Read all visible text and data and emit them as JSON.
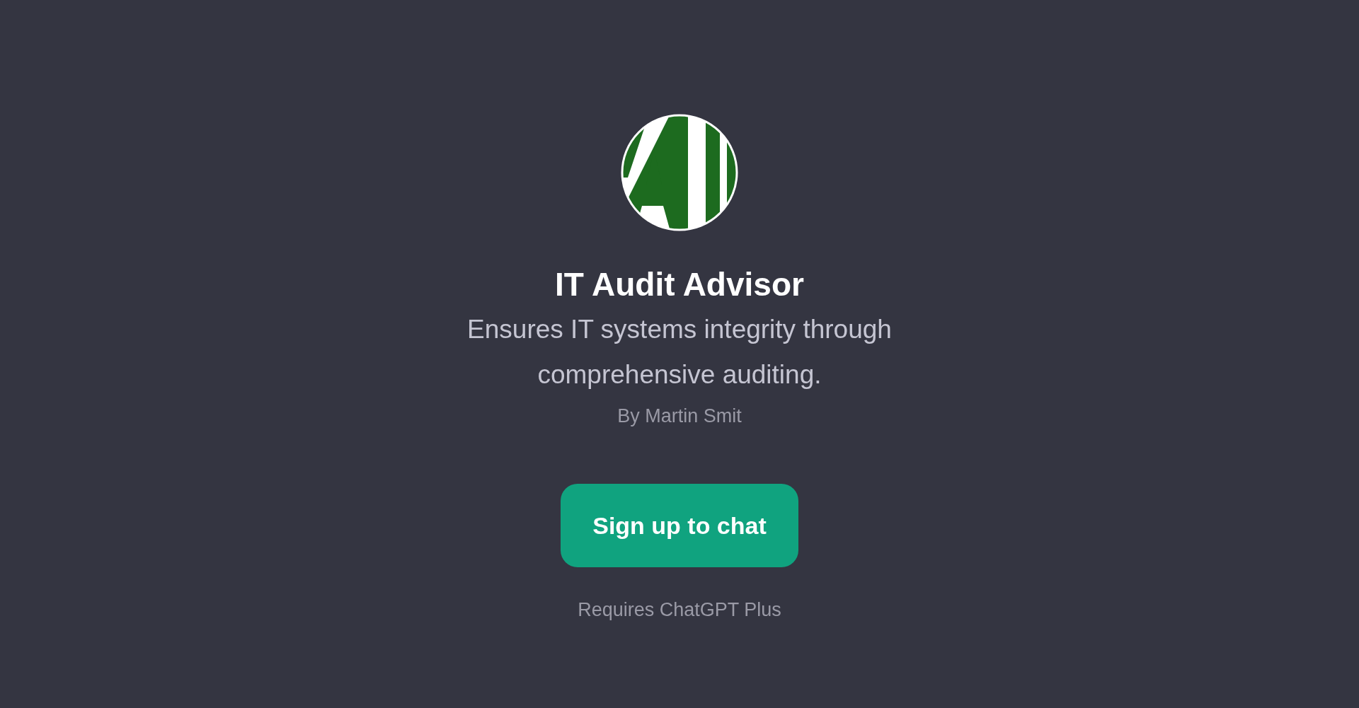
{
  "title": "IT Audit Advisor",
  "description": "Ensures IT systems integrity through comprehensive auditing.",
  "author": "By Martin Smit",
  "button": {
    "label": "Sign up to chat"
  },
  "note": "Requires ChatGPT Plus"
}
